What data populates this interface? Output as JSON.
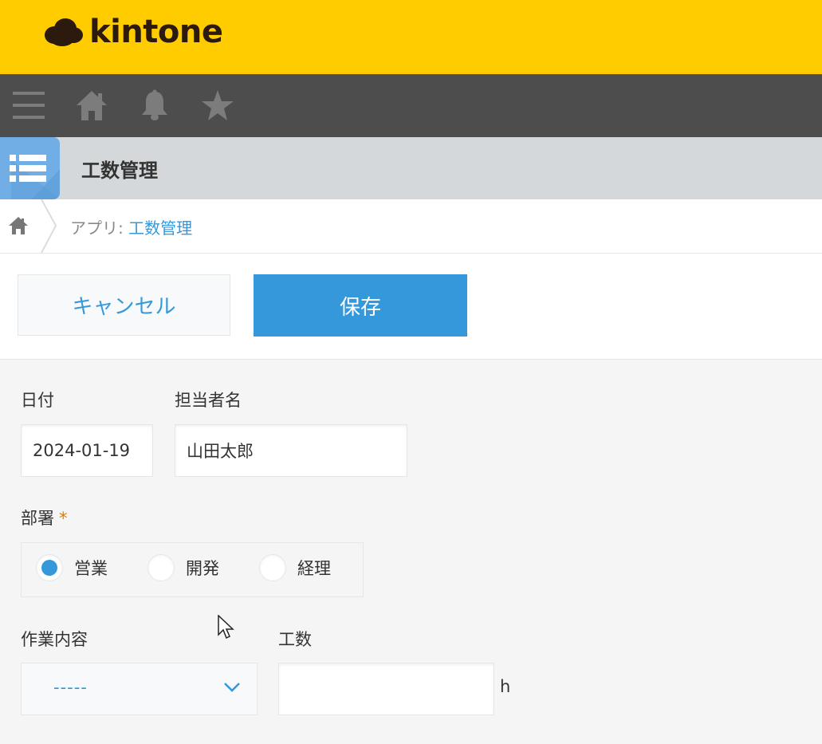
{
  "brand": {
    "name": "kintone",
    "bar_color": "#ffcc00"
  },
  "navbar": {
    "icons": [
      "menu-icon",
      "home-icon",
      "bell-icon",
      "star-icon"
    ]
  },
  "app": {
    "title": "工数管理"
  },
  "breadcrumb": {
    "prefix": "アプリ: ",
    "app_link": "工数管理"
  },
  "actions": {
    "cancel_label": "キャンセル",
    "save_label": "保存"
  },
  "form": {
    "date": {
      "label": "日付",
      "value": "2024-01-19"
    },
    "assignee": {
      "label": "担当者名",
      "value": "山田太郎"
    },
    "department": {
      "label": "部署",
      "required_mark": "*",
      "options": [
        "営業",
        "開発",
        "経理"
      ],
      "selected": "営業"
    },
    "task": {
      "label": "作業内容",
      "value": "-----"
    },
    "hours": {
      "label": "工数",
      "value": "",
      "unit": "h"
    }
  },
  "colors": {
    "accent": "#3498db",
    "nav": "#4d4d4d",
    "required": "#e07b00"
  }
}
